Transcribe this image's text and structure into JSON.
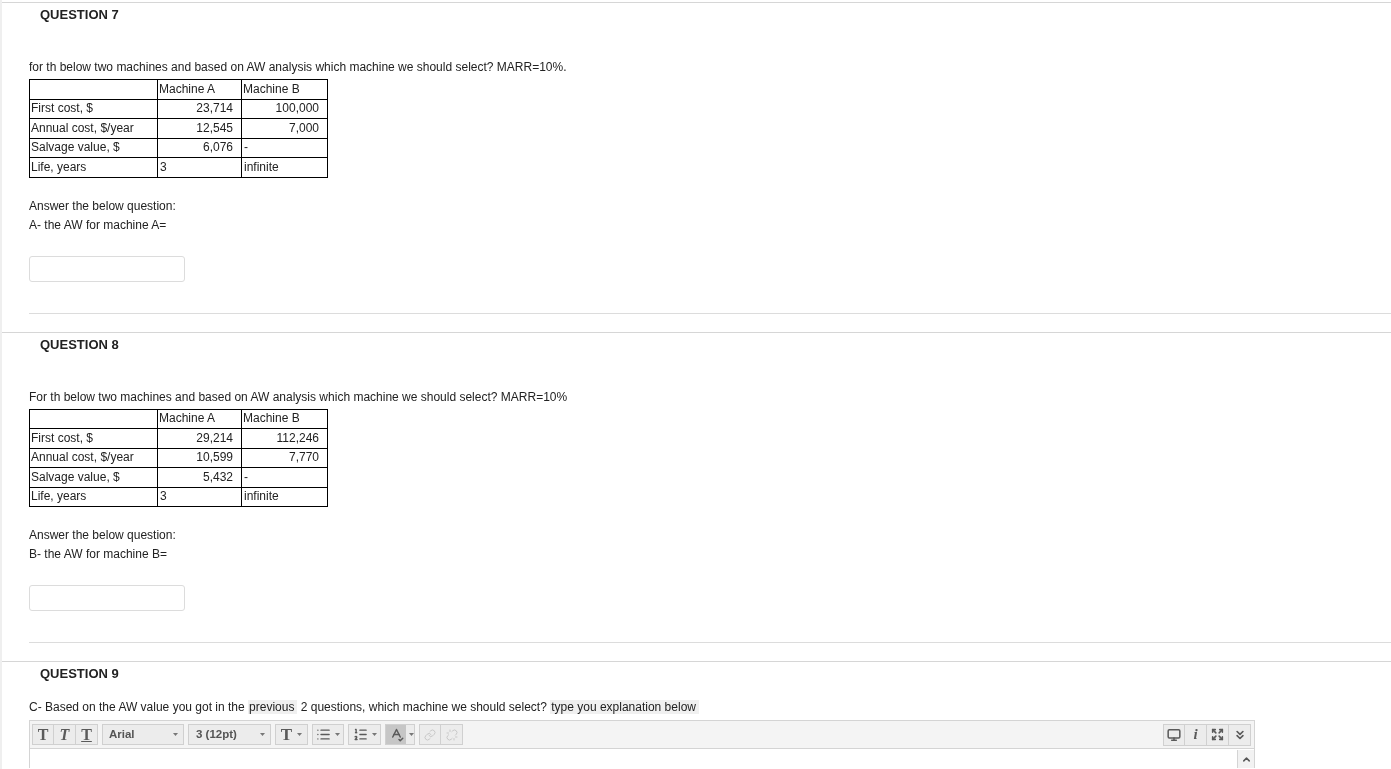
{
  "questions": [
    {
      "kind": "table",
      "heading": "QUESTION 7",
      "prompt": "for th below two machines and based on AW analysis which machine we should select? MARR=10%.",
      "table": {
        "columns": [
          "Machine A",
          "Machine B"
        ],
        "rows": [
          {
            "label": "First cost, $",
            "cells": [
              {
                "text": "23,714",
                "right_aligned": true
              },
              {
                "text": "100,000",
                "right_aligned": true
              }
            ]
          },
          {
            "label": "Annual cost, $/year",
            "cells": [
              {
                "text": "12,545",
                "right_aligned": true
              },
              {
                "text": "7,000",
                "right_aligned": true
              }
            ]
          },
          {
            "label": "Salvage value, $",
            "cells": [
              {
                "text": "6,076",
                "right_aligned": true
              },
              {
                "text": "-",
                "right_aligned": false
              }
            ]
          },
          {
            "label": "Life, years",
            "cells": [
              {
                "text": "3",
                "right_aligned": false
              },
              {
                "text": "infinite",
                "right_aligned": false
              }
            ]
          }
        ]
      },
      "instruction": "Answer the below question:",
      "sub_question": "A- the AW for machine A="
    },
    {
      "kind": "table",
      "heading": "QUESTION 8",
      "prompt": "For th below two machines and based on AW analysis which machine we should select? MARR=10%",
      "table": {
        "columns": [
          "Machine A",
          "Machine B"
        ],
        "rows": [
          {
            "label": "First cost, $",
            "cells": [
              {
                "text": "29,214",
                "right_aligned": true
              },
              {
                "text": "112,246",
                "right_aligned": true
              }
            ]
          },
          {
            "label": "Annual cost, $/year",
            "cells": [
              {
                "text": "10,599",
                "right_aligned": true
              },
              {
                "text": "7,770",
                "right_aligned": true
              }
            ]
          },
          {
            "label": "Salvage value, $",
            "cells": [
              {
                "text": "5,432",
                "right_aligned": true
              },
              {
                "text": "-",
                "right_aligned": false
              }
            ]
          },
          {
            "label": "Life, years",
            "cells": [
              {
                "text": "3",
                "right_aligned": false
              },
              {
                "text": "infinite",
                "right_aligned": false
              }
            ]
          }
        ]
      },
      "instruction": "Answer the below question:",
      "sub_question": "B- the AW for machine B="
    },
    {
      "kind": "essay",
      "heading": "QUESTION 9",
      "prompt_segments": [
        {
          "text": "C- Based on the AW value you got in the ",
          "highlighted": false
        },
        {
          "text": "previous",
          "highlighted": true
        },
        {
          "text": " 2 questions, which machine we should select? ",
          "highlighted": false
        },
        {
          "text": "type you explanation below",
          "highlighted": true
        }
      ],
      "toolbar": {
        "groups": [
          [
            {
              "kind": "bold",
              "label": "T",
              "pressed": false,
              "disabled": false
            },
            {
              "kind": "italic",
              "label": "T",
              "pressed": false,
              "disabled": false
            },
            {
              "kind": "underline",
              "label": "T",
              "pressed": false,
              "disabled": false
            }
          ],
          [
            {
              "kind": "font",
              "value": "Arial",
              "pressed": false,
              "disabled": false
            }
          ],
          [
            {
              "kind": "size",
              "value": "3 (12pt)",
              "pressed": false,
              "disabled": false
            }
          ],
          [
            {
              "kind": "text_color",
              "label": "T",
              "pressed": false,
              "disabled": false
            }
          ],
          [
            {
              "kind": "bullets",
              "pressed": false,
              "disabled": false
            }
          ],
          [
            {
              "kind": "numbering",
              "pressed": false,
              "disabled": false
            }
          ],
          [
            {
              "kind": "spellcheck",
              "pressed": true,
              "disabled": false
            }
          ],
          [
            {
              "kind": "link",
              "pressed": false,
              "disabled": true
            },
            {
              "kind": "unlink",
              "pressed": false,
              "disabled": true
            }
          ]
        ],
        "right": [
          {
            "kind": "preview",
            "pressed": false,
            "disabled": false
          },
          {
            "kind": "info",
            "label": "i",
            "pressed": false,
            "disabled": false
          },
          {
            "kind": "fullscreen",
            "pressed": false,
            "disabled": false
          },
          {
            "kind": "more",
            "pressed": false,
            "disabled": false
          }
        ]
      }
    }
  ]
}
